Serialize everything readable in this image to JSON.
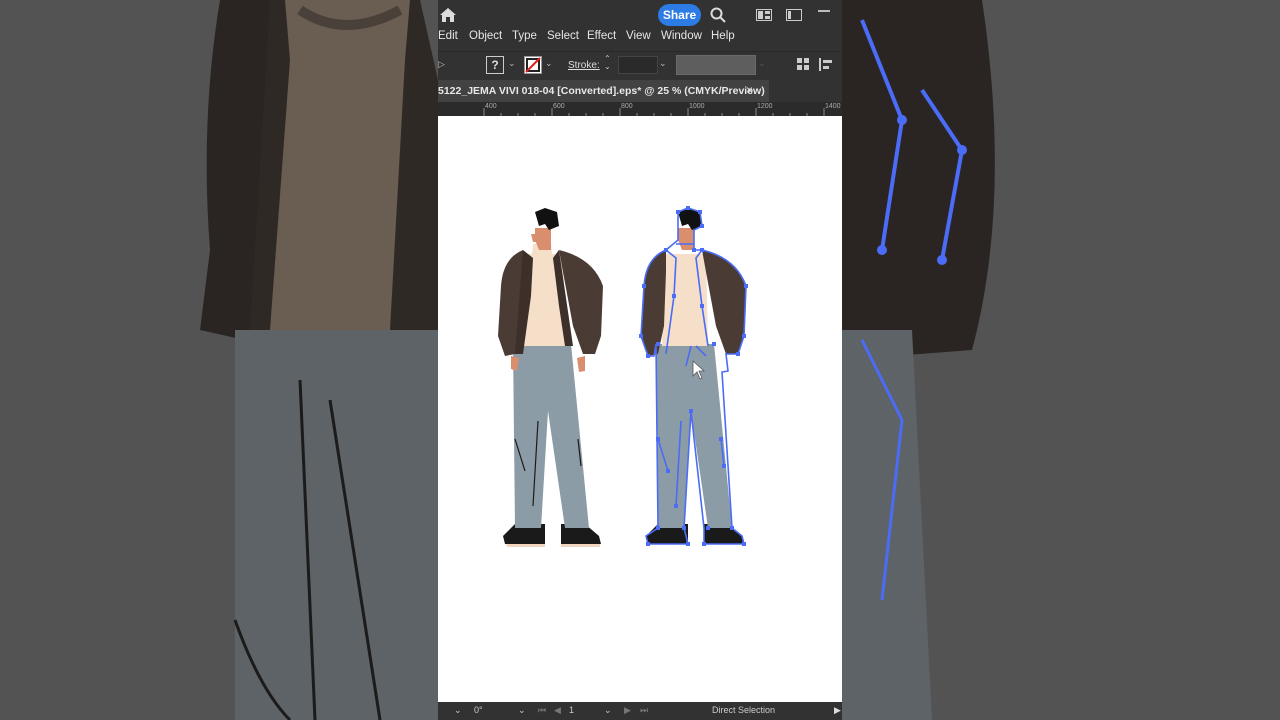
{
  "titlebar": {
    "share_label": "Share",
    "icons": [
      "home-icon",
      "search-icon",
      "arrange-documents-icon",
      "window-icon",
      "minimize-icon"
    ]
  },
  "menu": {
    "items": [
      "Edit",
      "Object",
      "Type",
      "Select",
      "Effect",
      "View",
      "Window",
      "Help"
    ]
  },
  "control_bar": {
    "fill_label": "?",
    "stroke_label": "Stroke:"
  },
  "document_tab": {
    "title": "5122_JEMA VIVI 018-04 [Converted].eps* @ 25 % (CMYK/Preview)",
    "close_label": "×"
  },
  "ruler": {
    "labels": [
      "400",
      "600",
      "800",
      "1000",
      "1200",
      "1400"
    ]
  },
  "status_bar": {
    "rotation": "0°",
    "artboard": "1",
    "tool": "Direct Selection"
  },
  "colors": {
    "accent": "#2d7be5",
    "selection": "#4a6cf7",
    "jacket": "#4a3b34",
    "shirt": "#f5dfc9",
    "pants": "#8c9ca6",
    "skin": "#d98f6e"
  }
}
